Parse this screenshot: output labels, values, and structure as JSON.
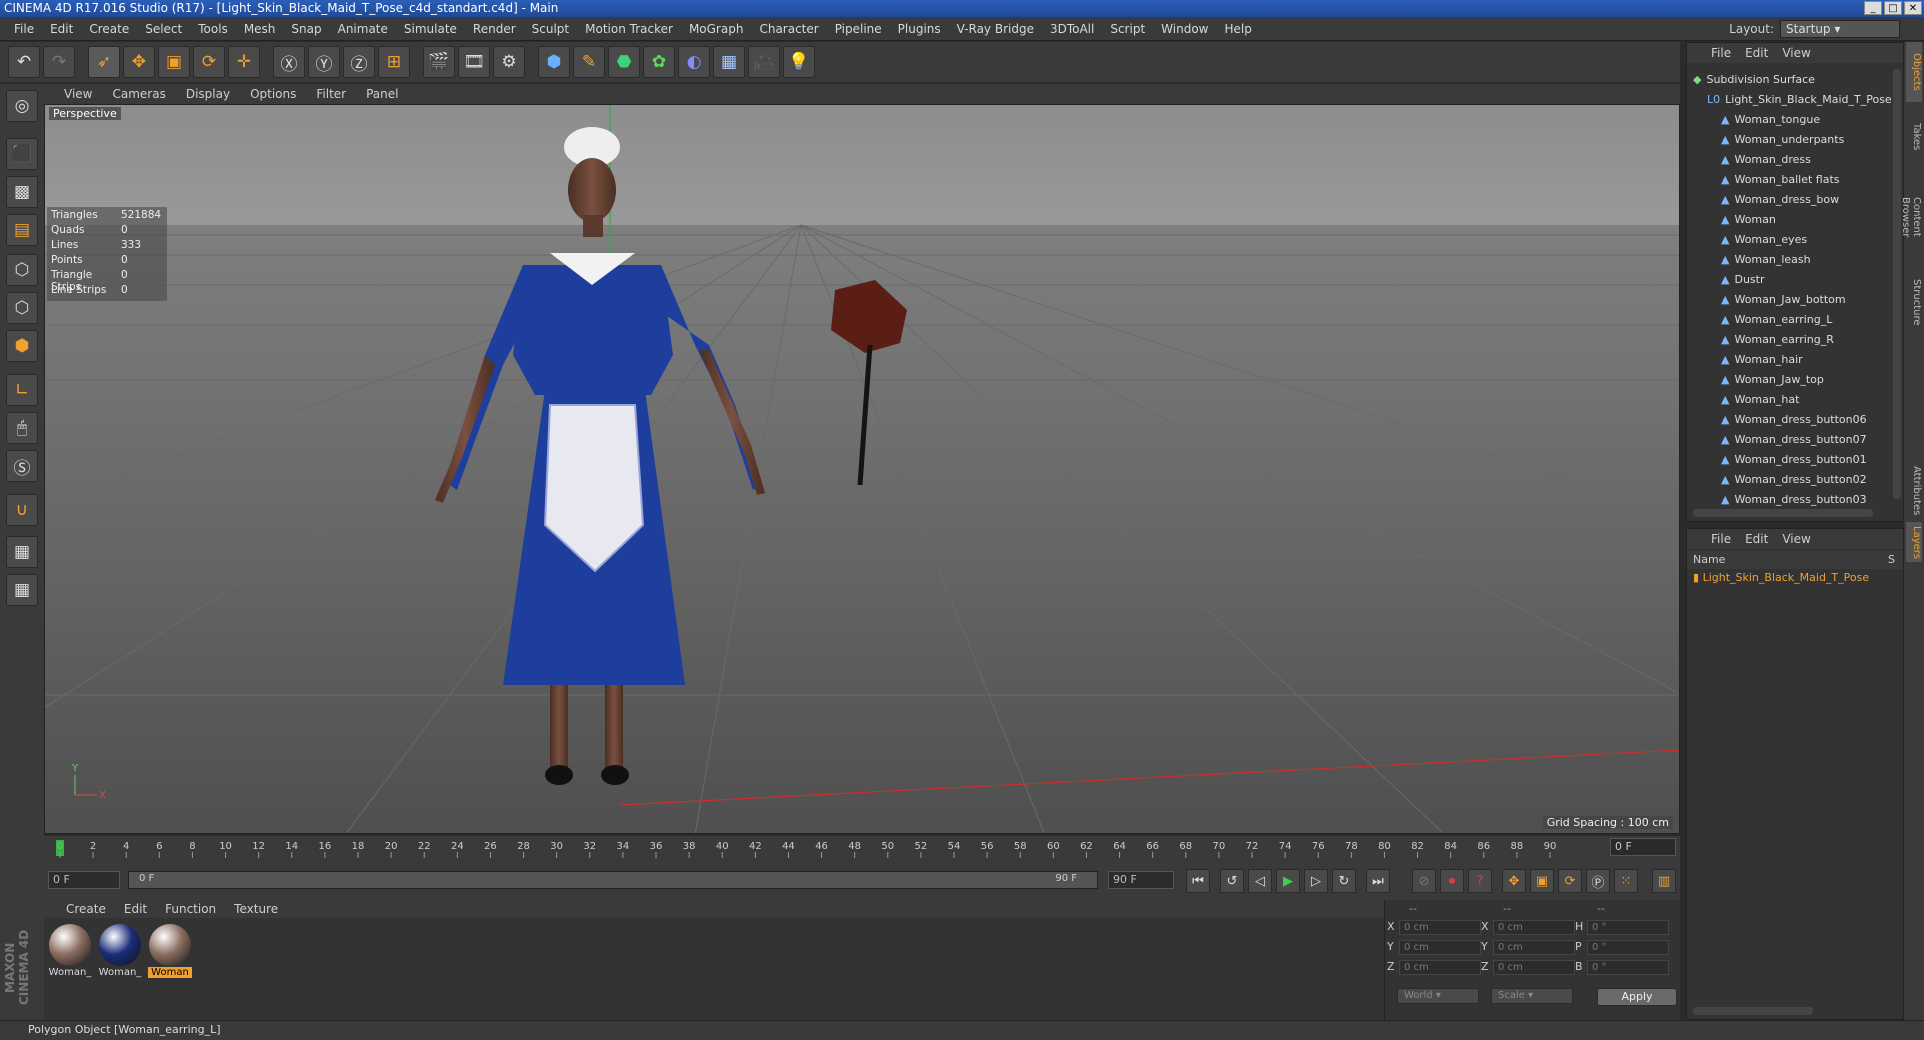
{
  "window": {
    "title": "CINEMA 4D R17.016 Studio (R17) - [Light_Skin_Black_Maid_T_Pose_c4d_standart.c4d] - Main"
  },
  "menubar": [
    "File",
    "Edit",
    "Create",
    "Select",
    "Tools",
    "Mesh",
    "Snap",
    "Animate",
    "Simulate",
    "Render",
    "Sculpt",
    "Motion Tracker",
    "MoGraph",
    "Character",
    "Pipeline",
    "Plugins",
    "V-Ray Bridge",
    "3DToAll",
    "Script",
    "Window",
    "Help"
  ],
  "layout": {
    "label": "Layout:",
    "value": "Startup"
  },
  "viewport": {
    "menu": [
      "View",
      "Cameras",
      "Display",
      "Options",
      "Filter",
      "Panel"
    ],
    "label": "Perspective",
    "stats": [
      {
        "k": "Triangles",
        "v": "521884"
      },
      {
        "k": "Quads",
        "v": "0"
      },
      {
        "k": "Lines",
        "v": "333"
      },
      {
        "k": "Points",
        "v": "0"
      },
      {
        "k": "Triangle Strips",
        "v": "0"
      },
      {
        "k": "Line Strips",
        "v": "0"
      }
    ],
    "grid_spacing": "Grid Spacing : 100 cm",
    "axis": {
      "y": "Y",
      "x": "X"
    }
  },
  "timeline": {
    "ticks": [
      "0",
      "2",
      "4",
      "6",
      "8",
      "10",
      "12",
      "14",
      "16",
      "18",
      "20",
      "22",
      "24",
      "26",
      "28",
      "30",
      "32",
      "34",
      "36",
      "38",
      "40",
      "42",
      "44",
      "46",
      "48",
      "50",
      "52",
      "54",
      "56",
      "58",
      "60",
      "62",
      "64",
      "66",
      "68",
      "70",
      "72",
      "74",
      "76",
      "78",
      "80",
      "82",
      "84",
      "86",
      "88",
      "90"
    ],
    "current_frame": "0 F"
  },
  "transport": {
    "start": "0 F",
    "slider_left": "0 F",
    "slider_right": "90 F",
    "end": "90 F"
  },
  "materials": {
    "menu": [
      "Create",
      "Edit",
      "Function",
      "Texture"
    ],
    "items": [
      {
        "label": "Woman_",
        "color": "#8a6e60"
      },
      {
        "label": "Woman_",
        "color": "#1a2d7a"
      },
      {
        "label": "Woman",
        "color": "#8a6e60"
      }
    ]
  },
  "coords": {
    "headers": [
      "--",
      "--",
      "--"
    ],
    "rows": [
      {
        "a": "X",
        "av": "0 cm",
        "b": "X",
        "bv": "0 cm",
        "c": "H",
        "cv": "0 °"
      },
      {
        "a": "Y",
        "av": "0 cm",
        "b": "Y",
        "bv": "0 cm",
        "c": "P",
        "cv": "0 °"
      },
      {
        "a": "Z",
        "av": "0 cm",
        "b": "Z",
        "bv": "0 cm",
        "c": "B",
        "cv": "0 °"
      }
    ],
    "mode1": "World",
    "mode2": "Scale",
    "apply": "Apply"
  },
  "status": "Polygon Object [Woman_earring_L]",
  "brand": "MAXON CINEMA 4D",
  "objects": {
    "menu": [
      "File",
      "Edit",
      "View"
    ],
    "items": [
      {
        "name": "Subdivision Surface",
        "indent": 0,
        "icon": "green"
      },
      {
        "name": "Light_Skin_Black_Maid_T_Pose",
        "indent": 1,
        "icon": "null"
      },
      {
        "name": "Woman_tongue",
        "indent": 2,
        "icon": "poly"
      },
      {
        "name": "Woman_underpants",
        "indent": 2,
        "icon": "poly"
      },
      {
        "name": "Woman_dress",
        "indent": 2,
        "icon": "poly"
      },
      {
        "name": "Woman_ballet flats",
        "indent": 2,
        "icon": "poly"
      },
      {
        "name": "Woman_dress_bow",
        "indent": 2,
        "icon": "poly"
      },
      {
        "name": "Woman",
        "indent": 2,
        "icon": "poly"
      },
      {
        "name": "Woman_eyes",
        "indent": 2,
        "icon": "poly"
      },
      {
        "name": "Woman_leash",
        "indent": 2,
        "icon": "poly"
      },
      {
        "name": "Dustr",
        "indent": 2,
        "icon": "poly"
      },
      {
        "name": "Woman_Jaw_bottom",
        "indent": 2,
        "icon": "poly"
      },
      {
        "name": "Woman_earring_L",
        "indent": 2,
        "icon": "poly"
      },
      {
        "name": "Woman_earring_R",
        "indent": 2,
        "icon": "poly"
      },
      {
        "name": "Woman_hair",
        "indent": 2,
        "icon": "poly"
      },
      {
        "name": "Woman_Jaw_top",
        "indent": 2,
        "icon": "poly"
      },
      {
        "name": "Woman_hat",
        "indent": 2,
        "icon": "poly"
      },
      {
        "name": "Woman_dress_button06",
        "indent": 2,
        "icon": "poly"
      },
      {
        "name": "Woman_dress_button07",
        "indent": 2,
        "icon": "poly"
      },
      {
        "name": "Woman_dress_button01",
        "indent": 2,
        "icon": "poly"
      },
      {
        "name": "Woman_dress_button02",
        "indent": 2,
        "icon": "poly"
      },
      {
        "name": "Woman_dress_button03",
        "indent": 2,
        "icon": "poly"
      }
    ]
  },
  "layers": {
    "menu": [
      "File",
      "Edit",
      "View"
    ],
    "col_name": "Name",
    "col_s": "S",
    "row": "Light_Skin_Black_Maid_T_Pose"
  },
  "side_tabs": [
    "Objects",
    "Takes",
    "Content Browser",
    "Structure",
    "Attributes",
    "Layers"
  ]
}
